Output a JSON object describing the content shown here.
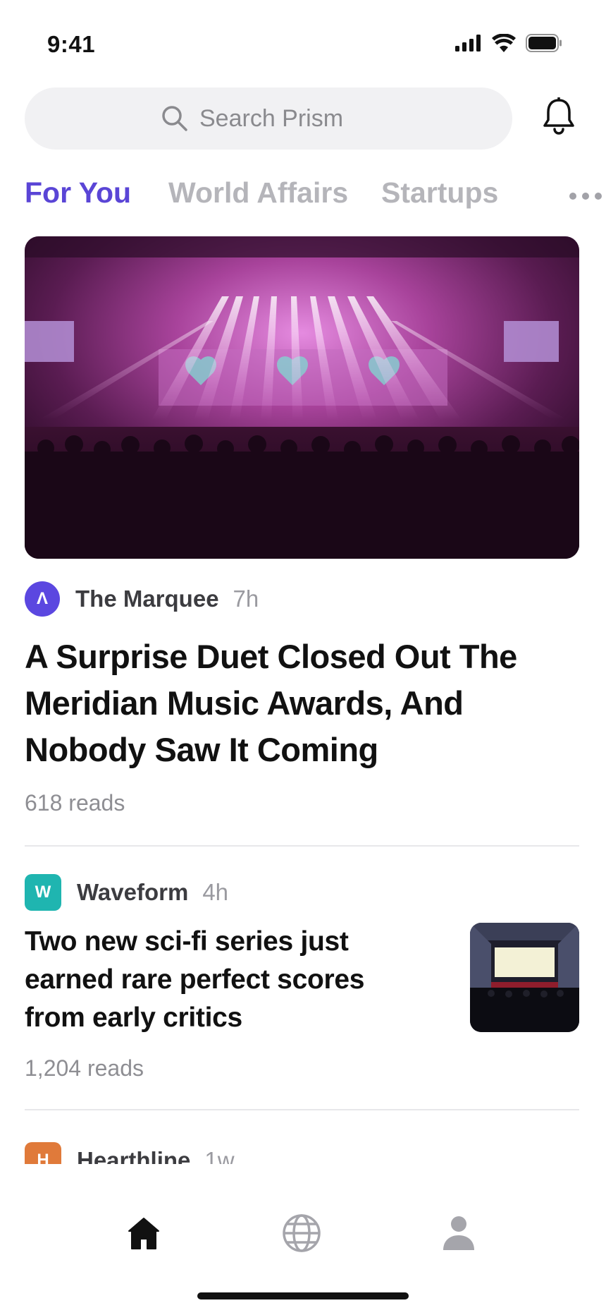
{
  "status_bar": {
    "time": "9:41",
    "icons": [
      "cellular-signal-icon",
      "wifi-icon",
      "battery-icon"
    ]
  },
  "search": {
    "placeholder": "Search Prism",
    "icon": "search-icon"
  },
  "header": {
    "notifications_icon": "bell-icon"
  },
  "tabs": [
    {
      "label": "For You",
      "active": true
    },
    {
      "label": "World Affairs",
      "active": false
    },
    {
      "label": "Startups",
      "active": false
    }
  ],
  "tabs_more_icon": "more-horizontal-icon",
  "colors": {
    "accent": "#5a45d6",
    "inactive_tab": "#b5b5ba",
    "meta_gray": "#8e8e93"
  },
  "feed": [
    {
      "source": "The Marquee",
      "source_logo_glyph": "Λ",
      "source_logo_color": "#5b47e0",
      "time_ago": "7h",
      "title": "A Surprise Duet Closed Out The Meridian Music Awards, And Nobody Saw It Coming",
      "reads": "618 reads",
      "image": "concert-stage-image"
    },
    {
      "source": "Waveform",
      "source_logo_glyph": "W",
      "source_logo_color": "#1fb5b0",
      "time_ago": "4h",
      "title": "Two new sci-fi series just earned rare perfect scores from early critics",
      "reads": "1,204 reads",
      "image": "cinema-screen-thumbnail"
    },
    {
      "source": "Hearthline",
      "source_logo_glyph": "H",
      "source_logo_color": "#e07a3a",
      "time_ago": "1w"
    }
  ],
  "tab_bar": [
    {
      "icon": "home-icon",
      "active": true
    },
    {
      "icon": "globe-icon",
      "active": false
    },
    {
      "icon": "profile-icon",
      "active": false
    }
  ]
}
